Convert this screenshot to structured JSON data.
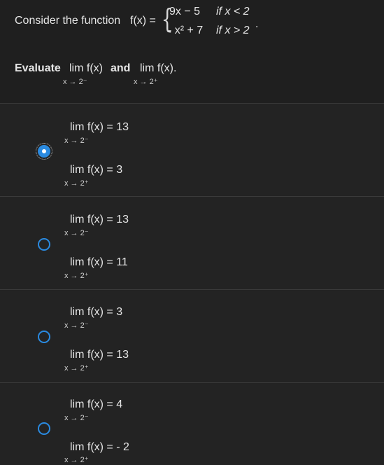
{
  "question": {
    "prefix": "Consider the function",
    "fx_label": "f(x) =",
    "brace": "{",
    "case1_expr": "9x − 5",
    "case1_cond": "if x < 2",
    "case2_expr": "- x² + 7",
    "case2_cond": "if x > 2",
    "period": ".",
    "evaluate_word": "Evaluate",
    "and_word": "and",
    "limit1_text": "lim  f(x)",
    "limit1_sub": "x → 2⁻",
    "limit2_text": "lim  f(x).",
    "limit2_sub": "x → 2⁺"
  },
  "options": [
    {
      "selected": true,
      "line1": "lim  f(x) = 13",
      "sub1": "x → 2⁻",
      "line2": "lim  f(x) = 3",
      "sub2": "x → 2⁺"
    },
    {
      "selected": false,
      "line1": "lim  f(x) = 13",
      "sub1": "x → 2⁻",
      "line2": "lim  f(x) = 11",
      "sub2": "x → 2⁺"
    },
    {
      "selected": false,
      "line1": "lim  f(x) = 3",
      "sub1": "x → 2⁻",
      "line2": "lim  f(x) = 13",
      "sub2": "x → 2⁺"
    },
    {
      "selected": false,
      "line1": "lim  f(x) = 4",
      "sub1": "x → 2⁻",
      "line2": "lim  f(x) = - 2",
      "sub2": "x → 2⁺"
    }
  ],
  "colors": {
    "accent": "#2a8ae0",
    "background": "#232323"
  }
}
